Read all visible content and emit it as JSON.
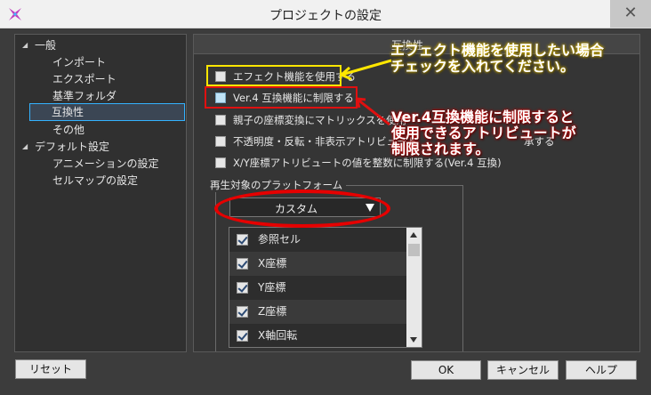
{
  "window": {
    "title": "プロジェクトの設定",
    "close_label": "✕"
  },
  "tree": {
    "items": [
      {
        "label": "一般",
        "expanded": true,
        "level": 0
      },
      {
        "label": "インポート",
        "level": 1
      },
      {
        "label": "エクスポート",
        "level": 1
      },
      {
        "label": "基準フォルダ",
        "level": 1
      },
      {
        "label": "互換性",
        "level": 1,
        "selected": true
      },
      {
        "label": "その他",
        "level": 1
      },
      {
        "label": "デフォルト設定",
        "expanded": true,
        "level": 0
      },
      {
        "label": "アニメーションの設定",
        "level": 1
      },
      {
        "label": "セルマップの設定",
        "level": 1
      }
    ]
  },
  "panel": {
    "header_title": "互換性",
    "options": [
      {
        "label": "エフェクト機能を使用する",
        "checked": false
      },
      {
        "label": "Ver.4 互換機能に制限する",
        "checked": false,
        "highlighted": true
      },
      {
        "label": "親子の座標変換にマトリックスを使用",
        "checked": false
      },
      {
        "label": "不透明度・反転・非表示アトリビュート",
        "trail": "承する",
        "checked": false
      },
      {
        "label": "X/Y座標アトリビュートの値を整数に制限する(Ver.4 互換)",
        "checked": false
      }
    ],
    "platform_group_label": "再生対象のプラットフォーム",
    "platform_value": "カスタム",
    "attributes": [
      {
        "label": "参照セル",
        "checked": true
      },
      {
        "label": "X座標",
        "checked": true
      },
      {
        "label": "Y座標",
        "checked": true
      },
      {
        "label": "Z座標",
        "checked": true
      },
      {
        "label": "X軸回転",
        "checked": true
      }
    ]
  },
  "buttons": {
    "reset": "リセット",
    "ok": "OK",
    "cancel": "キャンセル",
    "help": "ヘルプ"
  },
  "annotations": {
    "yellow_note": [
      "エフェクト機能を使用したい場合",
      "チェックを入れてください。"
    ],
    "red_note": [
      "Ver.4互換機能に制限すると",
      "使用できるアトリビュートが",
      "制限されます。"
    ],
    "yellow_color": "#ffe600",
    "red_color": "#e01010"
  }
}
